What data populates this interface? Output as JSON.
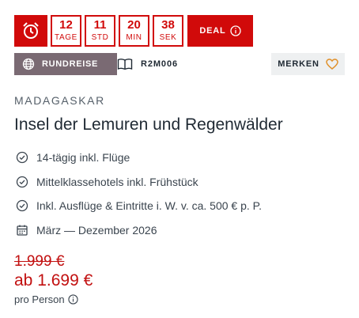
{
  "countdown": {
    "units": [
      {
        "value": "12",
        "label": "TAGE"
      },
      {
        "value": "11",
        "label": "STD"
      },
      {
        "value": "20",
        "label": "MIN"
      },
      {
        "value": "38",
        "label": "SEK"
      }
    ],
    "deal_label": "DEAL"
  },
  "tags": {
    "trip_type": "RUNDREISE",
    "trip_code": "R2M006",
    "save_label": "MERKEN"
  },
  "offer": {
    "country": "MADAGASKAR",
    "title": "Insel der Lemuren und Regenwälder",
    "features": [
      {
        "icon": "check-circle-icon",
        "text": "14-tägig inkl. Flüge"
      },
      {
        "icon": "check-circle-icon",
        "text": "Mittelklassehotels inkl. Frühstück"
      },
      {
        "icon": "check-circle-icon",
        "text": "Inkl. Ausflüge & Eintritte i. W. v. ca. 500 € p. P."
      },
      {
        "icon": "calendar-icon",
        "text": "März — Dezember 2026"
      }
    ]
  },
  "price": {
    "old": "1.999 €",
    "new": "ab 1.699 €",
    "unit": "pro Person"
  },
  "colors": {
    "accent": "#d10a0a",
    "tag_bg": "#7a6a73",
    "save_heart": "#e0902a"
  }
}
